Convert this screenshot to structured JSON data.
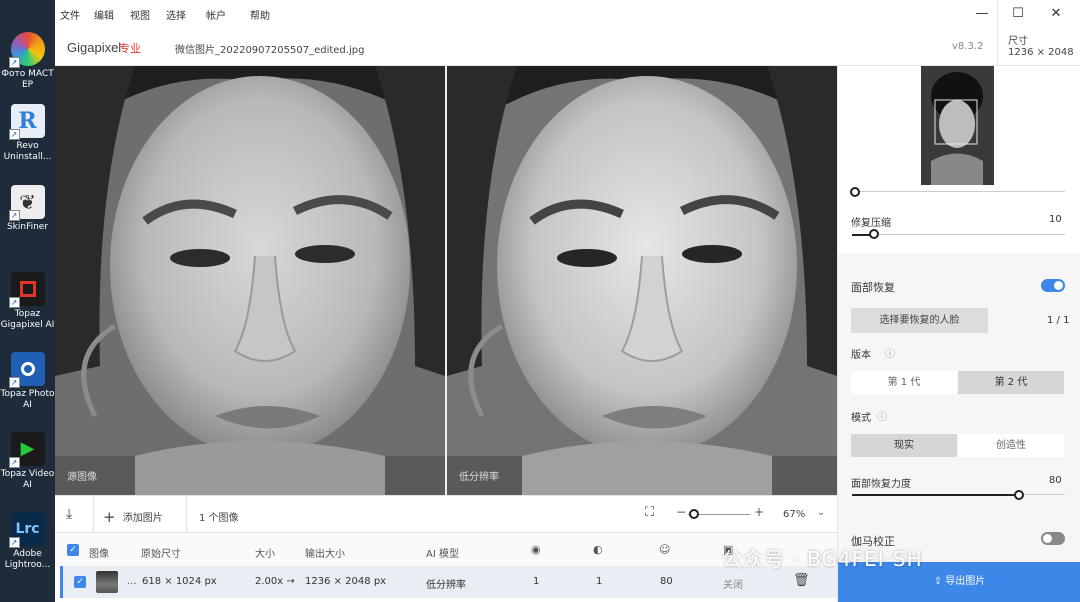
{
  "desktop": {
    "icons": [
      {
        "label": "Фото MACT EP",
        "color": "#e74c3c"
      },
      {
        "label": "Revo Uninstall...",
        "color": "#2d7fd8"
      },
      {
        "label": "SkinFiner",
        "color": "#6c6c6c"
      },
      {
        "label": "Topaz Gigapixel AI",
        "color": "#c0392b"
      },
      {
        "label": "Topaz Photo AI",
        "color": "#1f5fb4"
      },
      {
        "label": "Topaz Video AI",
        "color": "#27a33a"
      },
      {
        "label": "Adobe Lightroo...",
        "color": "#0a2a4a"
      }
    ]
  },
  "menu": {
    "items": [
      "文件",
      "编辑",
      "视图",
      "选择",
      "帐户",
      "帮助"
    ],
    "window_controls": {
      "minimize": "—",
      "maximize": "☐",
      "close": "✕"
    }
  },
  "header": {
    "brand": "Gigapixel",
    "brand_tag": "专业",
    "filename": "微信图片_20220907205507_edited.jpg",
    "version": "v8.3.2",
    "dims_label": "尺寸",
    "dims_value": "1236 × 2048"
  },
  "viewer": {
    "left_label": "源图像",
    "right_label": "低分辨率"
  },
  "toolbar": {
    "add_image": "添加图片",
    "image_count": "1 个图像",
    "zoom": "67%",
    "zoom_minus": "−",
    "zoom_plus": "+"
  },
  "list": {
    "headers": [
      "图像",
      "原始尺寸",
      "大小",
      "输出大小",
      "AI 模型"
    ],
    "row": {
      "ellipsis": "...",
      "original": "618 × 1024 px",
      "scale": "2.00x →",
      "output": "1236 × 2048 px",
      "model": "低分辨率",
      "v1": "1",
      "v2": "1",
      "v3": "80",
      "v4": "关闭"
    }
  },
  "sidebar": {
    "compress_label": "修复压缩",
    "compress_value": "10",
    "face_recovery": "面部恢复",
    "face_recovery_on": true,
    "select_face": "选择要恢复的人脸",
    "face_count": "1 / 1",
    "version_label": "版本",
    "gen1": "第 1 代",
    "gen2": "第 2 代",
    "mode_label": "模式",
    "mode_real": "现实",
    "mode_creative": "创造性",
    "strength_label": "面部恢复力度",
    "strength_value": "80",
    "gamma_label": "伽马校正",
    "export": "导出图片"
  },
  "watermark": "公众号 · BG4FEI-SH",
  "colors": {
    "accent": "#3d87e8",
    "brand_red": "#e0342c"
  }
}
